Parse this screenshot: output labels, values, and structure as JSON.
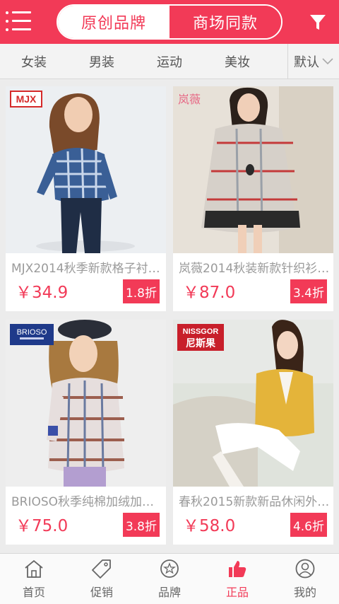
{
  "header": {
    "tabs": [
      {
        "label": "原创品牌",
        "active": true
      },
      {
        "label": "商场同款",
        "active": false
      }
    ],
    "accent_color": "#f23a57"
  },
  "categories": {
    "items": [
      "女装",
      "男装",
      "运动",
      "美妆"
    ],
    "sort_label": "默认"
  },
  "products": [
    {
      "brand": "MJX",
      "title": "MJX2014秋季新款格子衬…",
      "price": "￥34.9",
      "discount": "1.8折"
    },
    {
      "brand": "岚薇",
      "title": "岚薇2014秋装新款针织衫…",
      "price": "￥87.0",
      "discount": "3.4折"
    },
    {
      "brand": "BRIOSO",
      "title": "BRIOSO秋季纯棉加绒加…",
      "price": "￥75.0",
      "discount": "3.8折"
    },
    {
      "brand": "NISSGOR 尼斯果",
      "title": "春秋2015新款新品休闲外…",
      "price": "￥58.0",
      "discount": "4.6折"
    }
  ],
  "bottom_nav": [
    {
      "label": "首页",
      "icon": "home-icon",
      "active": false
    },
    {
      "label": "促销",
      "icon": "tag-icon",
      "active": false
    },
    {
      "label": "品牌",
      "icon": "star-badge-icon",
      "active": false
    },
    {
      "label": "正品",
      "icon": "thumbs-up-icon",
      "active": true
    },
    {
      "label": "我的",
      "icon": "user-icon",
      "active": false
    }
  ]
}
